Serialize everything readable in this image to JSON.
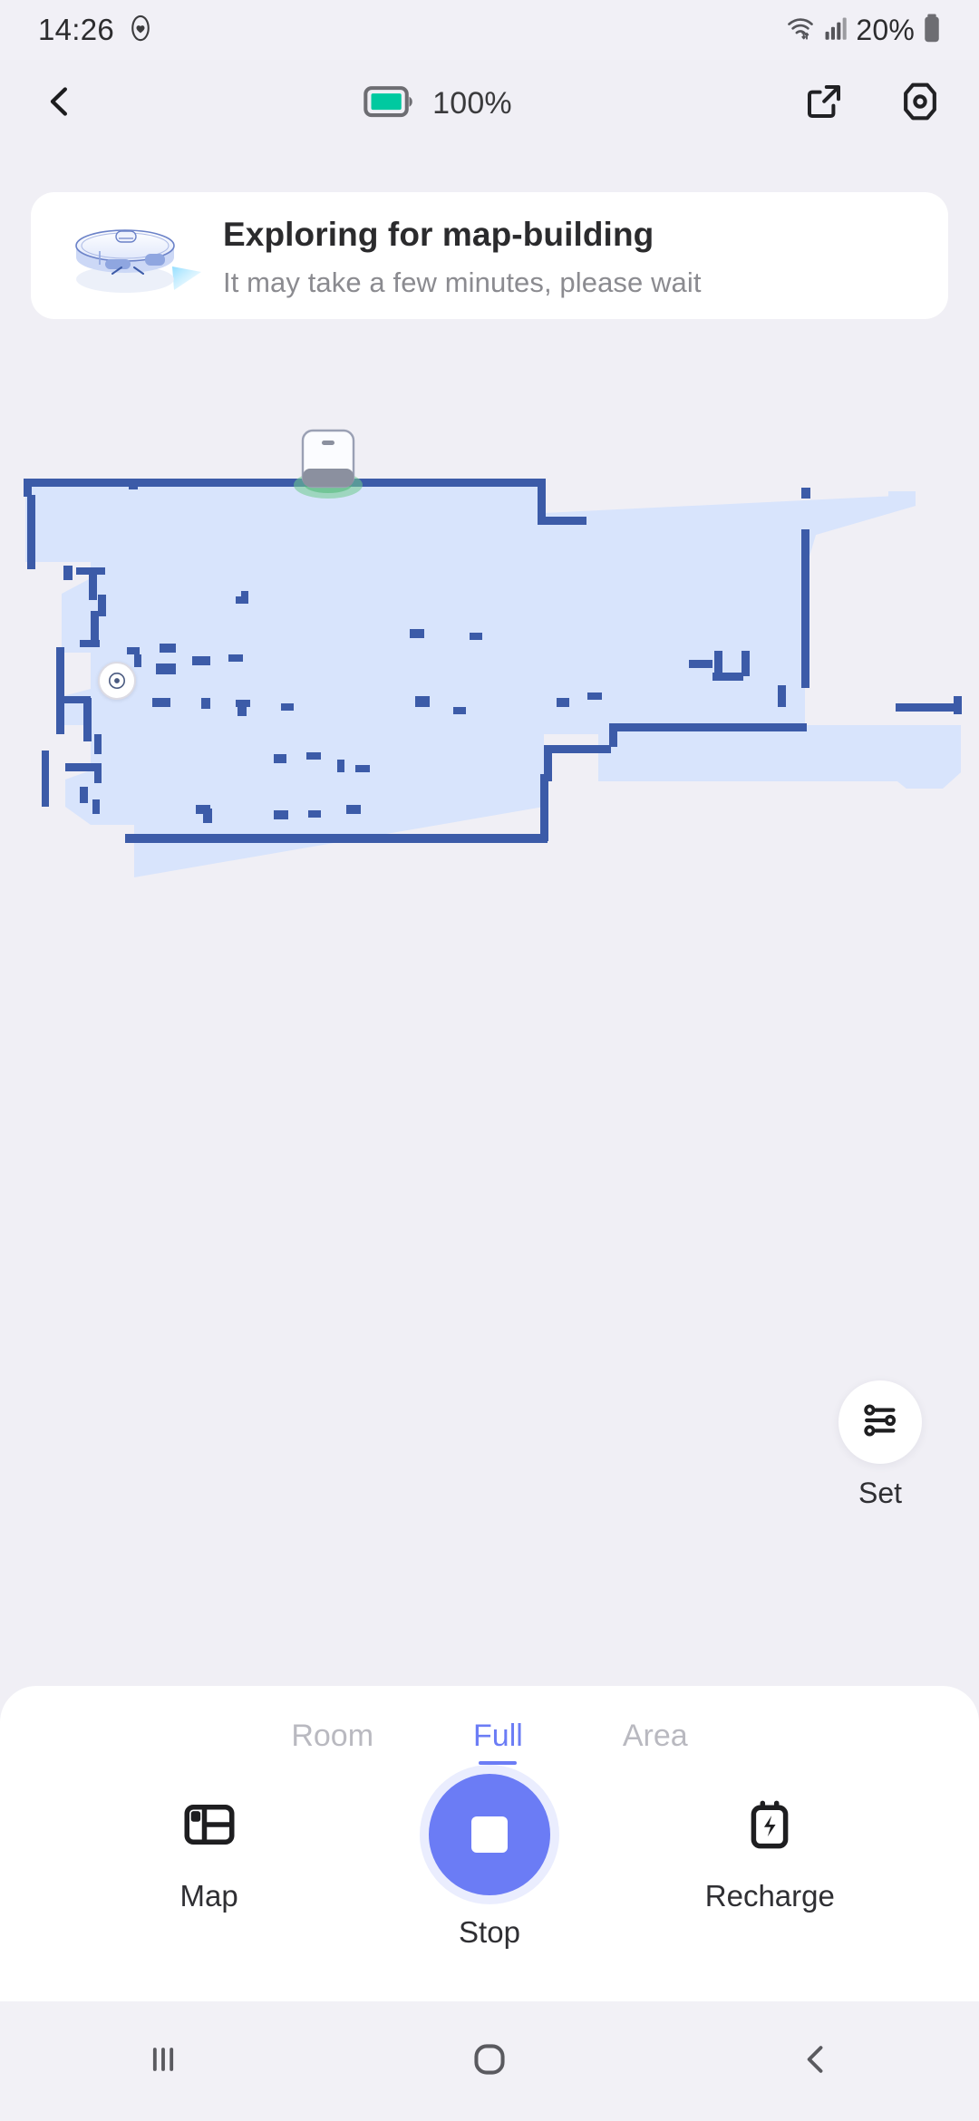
{
  "status_bar": {
    "time": "14:26",
    "icons": [
      "heart-circle-icon",
      "wifi-icon",
      "cellular-signal-icon"
    ],
    "battery_percent": "20%"
  },
  "app_bar": {
    "back_icon": "chevron-left-icon",
    "battery_label": "100%",
    "battery_icon": "battery-full-icon",
    "battery_color": "#00C9A0",
    "share_icon": "share-external-icon",
    "settings_icon": "hex-nut-settings-icon"
  },
  "status_card": {
    "illustration": "robot-vacuum-illustration",
    "title": "Exploring for map-building",
    "subtitle": "It may take a few minutes, please wait"
  },
  "map": {
    "floor_color": "#D8E4FC",
    "wall_color": "#3C5BA8",
    "dock_icon": "charging-dock-icon",
    "dock_glow_color": "#6FCB8C",
    "robot_marker_icon": "robot-position-icon"
  },
  "set_button": {
    "icon": "settings-sliders-icon",
    "label": "Set"
  },
  "bottom_sheet": {
    "tabs": [
      {
        "label": "Room",
        "active": false
      },
      {
        "label": "Full",
        "active": true
      },
      {
        "label": "Area",
        "active": false
      }
    ],
    "accent_color": "#6B7CF5",
    "actions": [
      {
        "label": "Map",
        "icon": "map-layout-icon"
      },
      {
        "label": "Stop",
        "icon": "stop-square-icon"
      },
      {
        "label": "Recharge",
        "icon": "battery-charging-icon"
      }
    ]
  },
  "nav_bar": {
    "recents_icon": "recents-bars-icon",
    "home_icon": "home-circle-icon",
    "back_icon": "nav-back-icon"
  }
}
